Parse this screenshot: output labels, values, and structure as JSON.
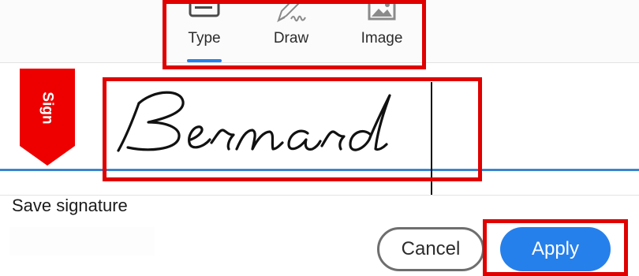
{
  "tabs": [
    {
      "label": "Type",
      "icon": "keyboard-icon",
      "active": true
    },
    {
      "label": "Draw",
      "icon": "pen-icon",
      "active": false
    },
    {
      "label": "Image",
      "icon": "image-icon",
      "active": false
    }
  ],
  "sign_flag": {
    "label": "Sign",
    "color": "#ee0000"
  },
  "signature": {
    "text": "Bernard"
  },
  "save_signature": {
    "label": "Save signature"
  },
  "buttons": {
    "cancel": "Cancel",
    "apply": "Apply"
  },
  "colors": {
    "accent": "#2680eb",
    "highlight": "#e00000",
    "signature_line": "#3a85cf"
  }
}
